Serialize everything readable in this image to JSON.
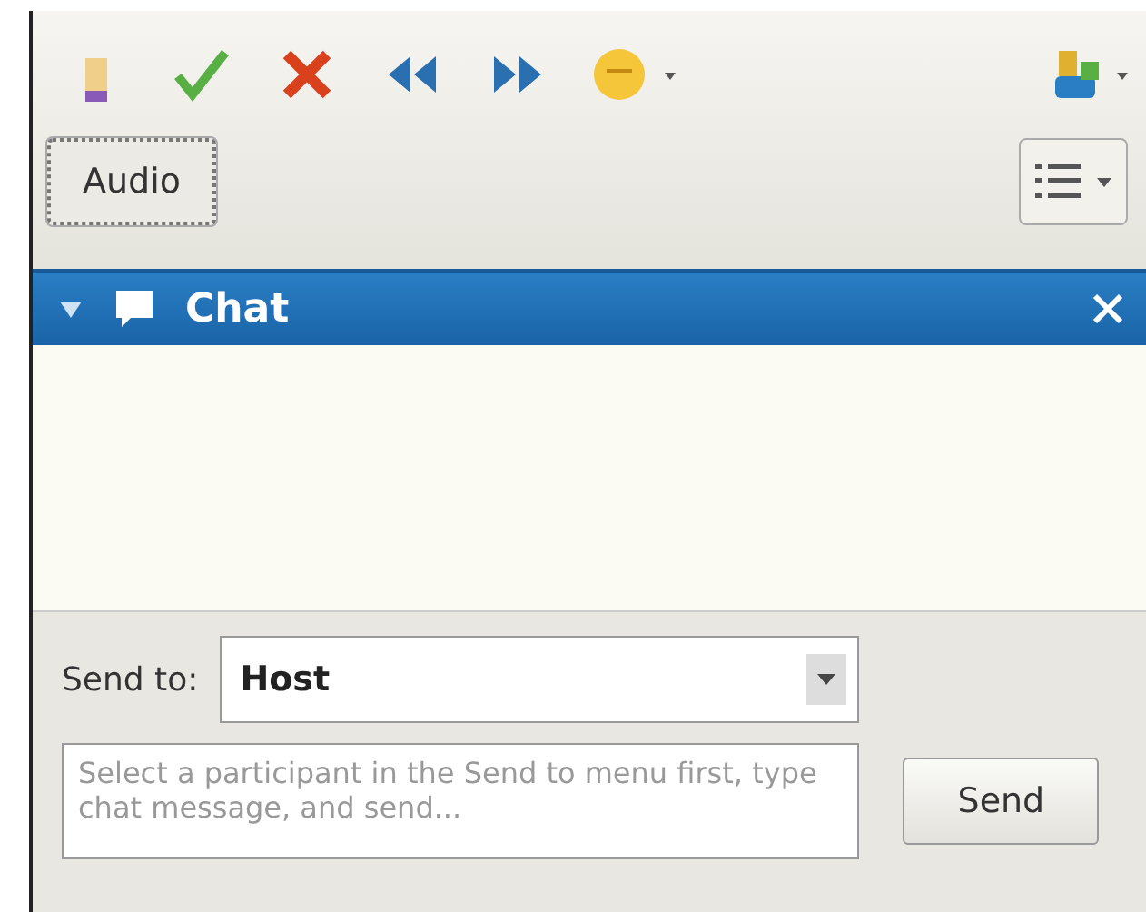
{
  "toolbar": {
    "audio_button": "Audio"
  },
  "chat_panel": {
    "title": "Chat",
    "expanded": true
  },
  "send_to": {
    "label": "Send to:",
    "value": "Host"
  },
  "message": {
    "placeholder": "Select a participant in the Send to menu first, type chat message, and send..."
  },
  "send_button": "Send"
}
